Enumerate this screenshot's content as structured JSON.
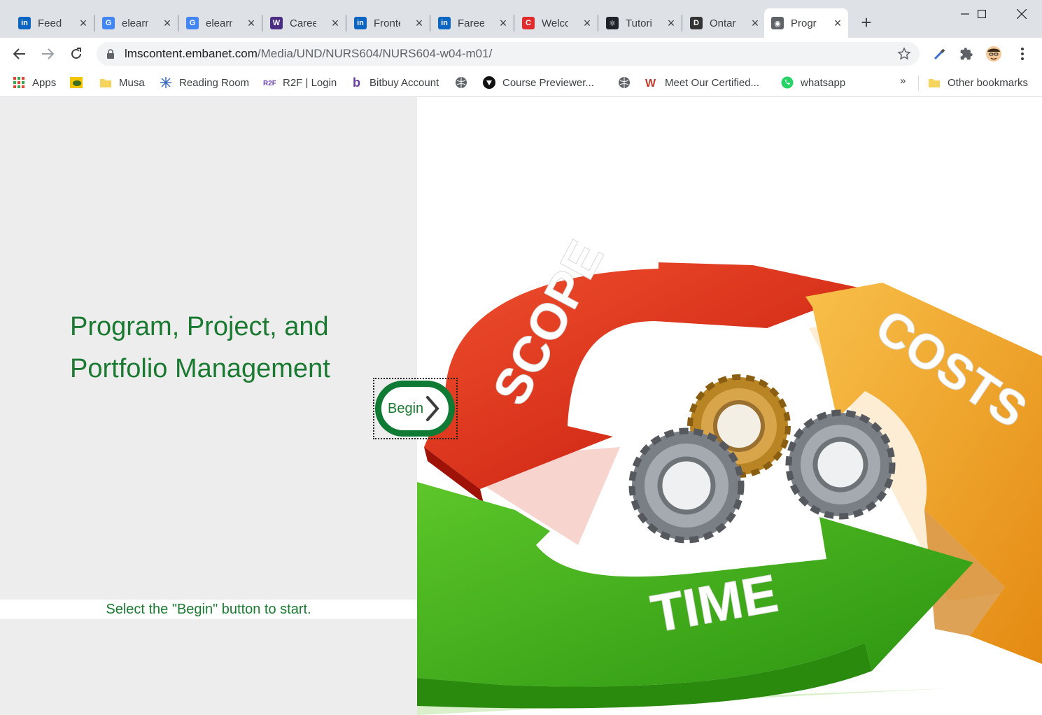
{
  "tabs": [
    {
      "title": "Feed |",
      "icon": "linkedin-icon",
      "color": "#0a66c2",
      "glyph": "in"
    },
    {
      "title": "elearn",
      "icon": "google-icon",
      "color": "#4285f4",
      "glyph": "G"
    },
    {
      "title": "elearn",
      "icon": "google-icon",
      "color": "#4285f4",
      "glyph": "G"
    },
    {
      "title": "Career",
      "icon": "university-shield-icon",
      "color": "#4b2e83",
      "glyph": "W"
    },
    {
      "title": "Fronte",
      "icon": "linkedin-icon",
      "color": "#0a66c2",
      "glyph": "in"
    },
    {
      "title": "Fareed",
      "icon": "linkedin-icon",
      "color": "#0a66c2",
      "glyph": "in"
    },
    {
      "title": "Welco",
      "icon": "c-logo-icon",
      "color": "#e02c2c",
      "glyph": "C"
    },
    {
      "title": "Tutori",
      "icon": "react-icon",
      "color": "#20232a",
      "glyph": "⚛"
    },
    {
      "title": "Ontar",
      "icon": "dms-icon",
      "color": "#333333",
      "glyph": "D"
    },
    {
      "title": "Progr",
      "icon": "globe-icon",
      "color": "#5f6368",
      "glyph": "◉",
      "active": true
    }
  ],
  "address": {
    "host": "lmscontent.embanet.com",
    "path": "/Media/UND/NURS604/NURS604-w04-m01/"
  },
  "bookmarks": [
    {
      "label": "Apps",
      "icon": "apps-grid-icon"
    },
    {
      "label": "",
      "icon": "turtle-icon"
    },
    {
      "label": "Musa",
      "icon": "folder-icon"
    },
    {
      "label": "Reading Room",
      "icon": "sparkle-icon"
    },
    {
      "label": "R2F | Login",
      "icon": "r2f-icon"
    },
    {
      "label": "Bitbuy Account",
      "icon": "bitbuy-icon"
    },
    {
      "label": "",
      "icon": "globe-icon"
    },
    {
      "label": "Course Previewer...",
      "icon": "previewer-icon"
    },
    {
      "label": "",
      "icon": "globe-icon"
    },
    {
      "label": "Meet Our Certified...",
      "icon": "certified-icon"
    },
    {
      "label": "whatsapp",
      "icon": "whatsapp-icon"
    }
  ],
  "bookmarks_overflow": "»",
  "other_bookmarks": "Other bookmarks",
  "page": {
    "title_line1": "Program, Project, and",
    "title_line2": "Portfolio Management",
    "begin_label": "Begin",
    "instruction": "Select the \"Begin\" button to start.",
    "hero_words": [
      "SCOPE",
      "COSTS",
      "TIME"
    ]
  },
  "colors": {
    "accent_green": "#1b7a32",
    "begin_border": "#0e7a34",
    "scope_red": "#e0301e",
    "costs_orange": "#f2a31e",
    "time_green": "#3bab17"
  }
}
